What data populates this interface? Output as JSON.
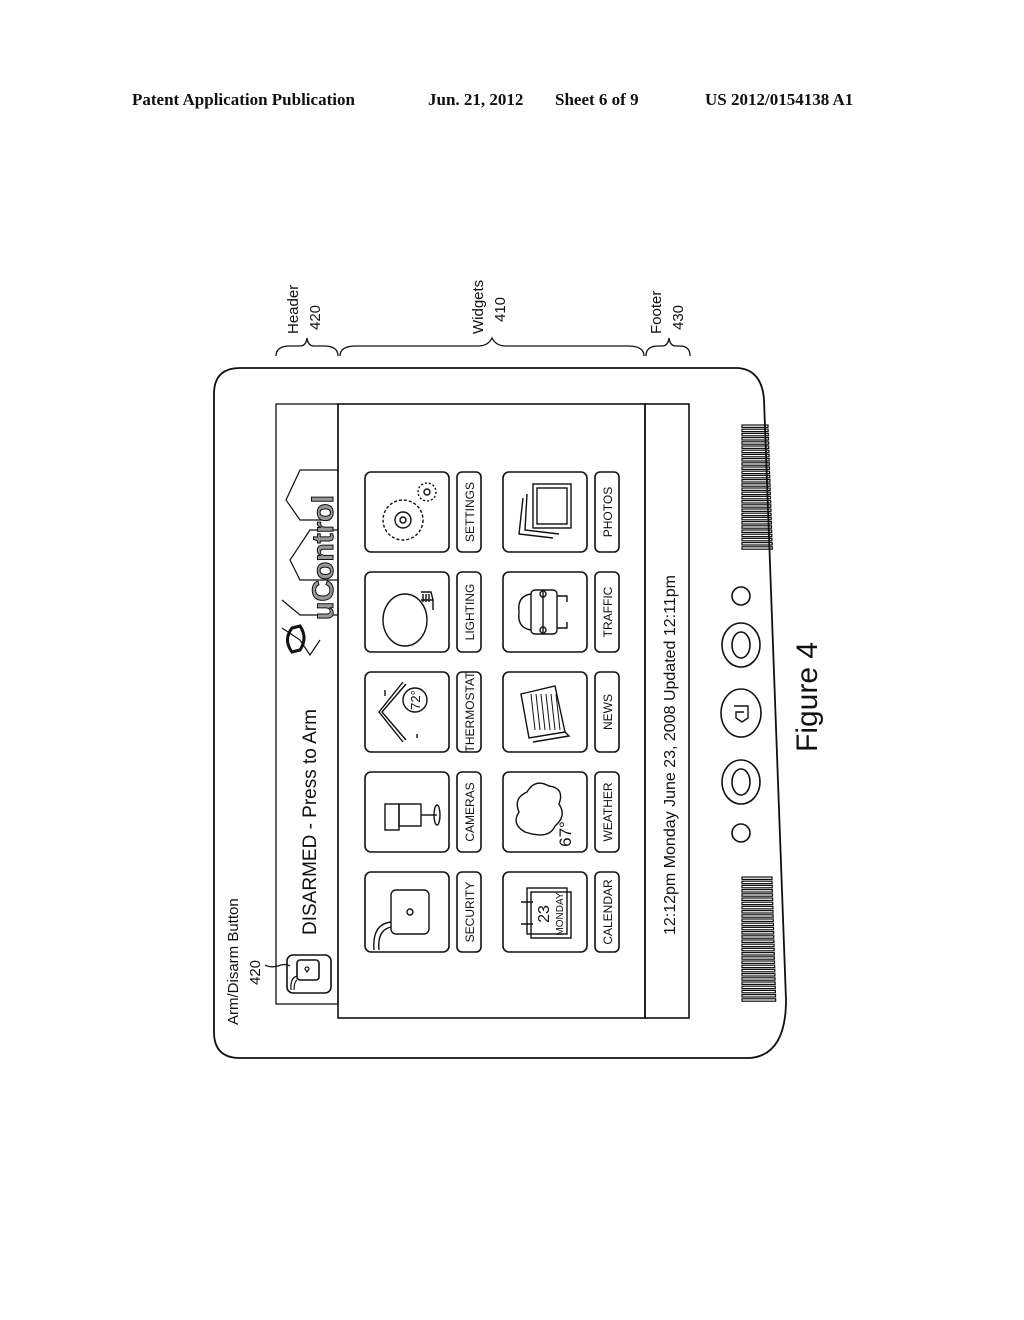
{
  "publication": {
    "title": "Patent Application Publication",
    "date": "Jun. 21, 2012",
    "sheet": "Sheet 6 of 9",
    "number": "US 2012/0154138 A1"
  },
  "callouts": {
    "header": {
      "label": "Header",
      "ref": "420"
    },
    "widgets": {
      "label": "Widgets",
      "ref": "410"
    },
    "footer": {
      "label": "Footer",
      "ref": "430"
    },
    "arm_button": {
      "label": "Arm/Disarm  Button",
      "ref": "420"
    }
  },
  "screen": {
    "header": {
      "status_text": "DISARMED - Press to Arm",
      "logo_text": "uControl",
      "arm_icon": "lock-icon"
    },
    "widgets": [
      {
        "label": "SECURITY",
        "icon": "lock-icon"
      },
      {
        "label": "CAMERAS",
        "icon": "camera-icon"
      },
      {
        "label": "THERMOSTAT",
        "icon": "thermostat-house-icon",
        "value": "72°"
      },
      {
        "label": "LIGHTING",
        "icon": "light-bulb-icon"
      },
      {
        "label": "SETTINGS",
        "icon": "gears-icon"
      },
      {
        "label": "CALENDAR",
        "icon": "calendar-icon",
        "day_number": "23",
        "day_name": "MONDAY"
      },
      {
        "label": "WEATHER",
        "icon": "cloud-icon",
        "value": "67°"
      },
      {
        "label": "NEWS",
        "icon": "newspaper-icon"
      },
      {
        "label": "TRAFFIC",
        "icon": "car-icon"
      },
      {
        "label": "PHOTOS",
        "icon": "photos-icon"
      }
    ],
    "footer": {
      "status_text": "12:12pm Monday June 23, 2008 Updated 12:11pm"
    }
  },
  "device": {
    "buttons": [
      "small-round-button",
      "oval-button",
      "home-logo-button",
      "oval-button",
      "small-round-button"
    ]
  },
  "figure_caption": "Figure 4"
}
